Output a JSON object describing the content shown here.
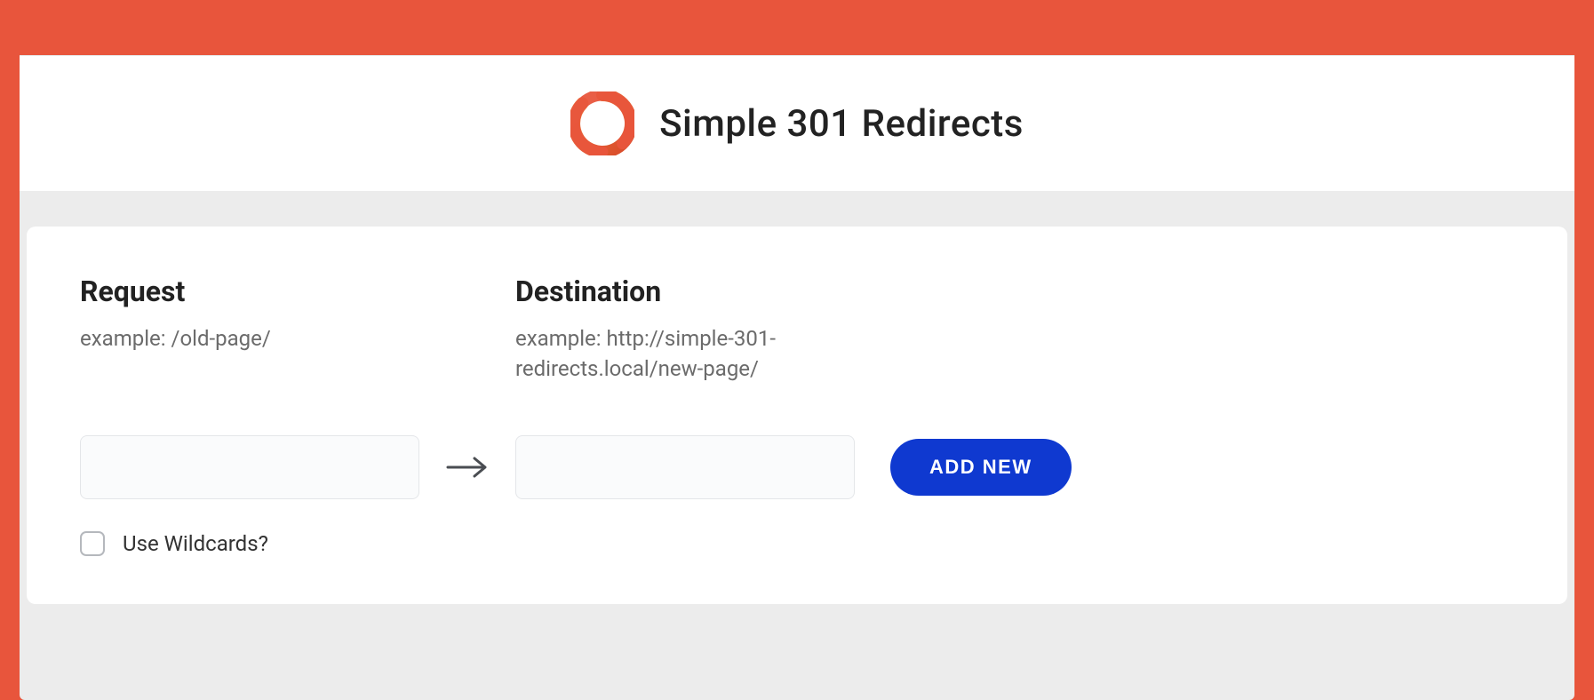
{
  "header": {
    "title": "Simple 301 Redirects"
  },
  "form": {
    "request_heading": "Request",
    "request_example": "example: /old-page/",
    "destination_heading": "Destination",
    "destination_example": "example: http://simple-301-redirects.local/new-page/",
    "request_value": "",
    "destination_value": "",
    "add_button_label": "ADD NEW",
    "wildcards_label": "Use Wildcards?",
    "wildcards_checked": false
  }
}
